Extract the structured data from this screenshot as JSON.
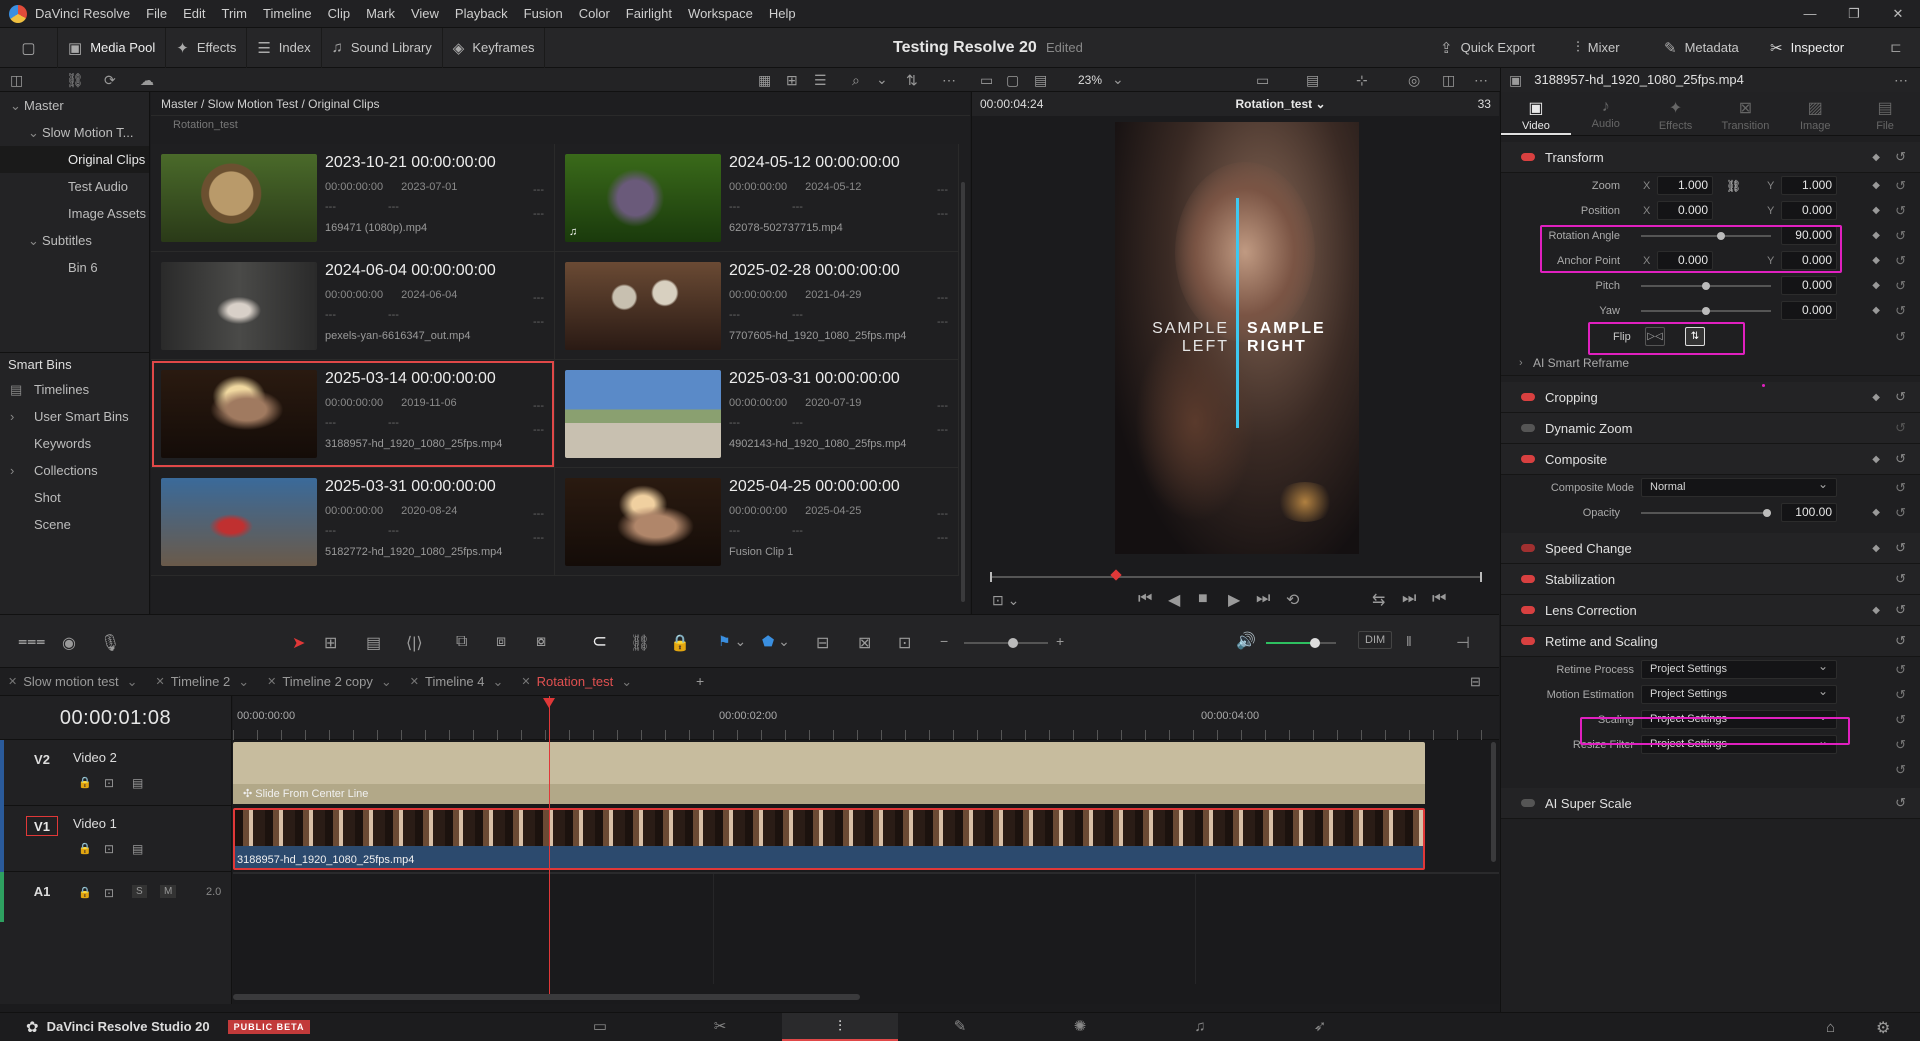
{
  "menubar": {
    "app_name": "DaVinci Resolve",
    "items": [
      "File",
      "Edit",
      "Trim",
      "Timeline",
      "Clip",
      "Mark",
      "View",
      "Playback",
      "Fusion",
      "Color",
      "Fairlight",
      "Workspace",
      "Help"
    ]
  },
  "toolbar": {
    "media_pool": "Media Pool",
    "effects": "Effects",
    "index": "Index",
    "sound_library": "Sound Library",
    "keyframes": "Keyframes",
    "project_title": "Testing Resolve 20",
    "project_status": "Edited",
    "quick_export": "Quick Export",
    "mixer": "Mixer",
    "metadata": "Metadata",
    "inspector": "Inspector",
    "zoom": "23%"
  },
  "bins": {
    "items": [
      {
        "label": "Master",
        "indent": 0,
        "arrow": "⌄"
      },
      {
        "label": "Slow Motion T...",
        "indent": 1,
        "arrow": "⌄"
      },
      {
        "label": "Original Clips",
        "indent": 2,
        "arrow": "",
        "selected": true
      },
      {
        "label": "Test Audio",
        "indent": 2,
        "arrow": ""
      },
      {
        "label": "Image Assets",
        "indent": 2,
        "arrow": ""
      },
      {
        "label": "Subtitles",
        "indent": 1,
        "arrow": "⌄"
      },
      {
        "label": "Bin 6",
        "indent": 2,
        "arrow": ""
      }
    ],
    "smart_bins_title": "Smart Bins",
    "smart_bins": [
      {
        "label": "Timelines",
        "arrow": ""
      },
      {
        "label": "User Smart Bins",
        "arrow": "›"
      },
      {
        "label": "Keywords",
        "arrow": ""
      },
      {
        "label": "Collections",
        "arrow": "›"
      },
      {
        "label": "Shot",
        "arrow": ""
      },
      {
        "label": "Scene",
        "arrow": ""
      }
    ]
  },
  "mediapool": {
    "breadcrumb": "Master / Slow Motion Test / Original Clips",
    "sub": "Rotation_test",
    "clips": [
      {
        "title": "2023-10-21  00:00:00:00",
        "tc": "00:00:00:00",
        "date": "2023-07-01",
        "file": "169471 (1080p).mp4",
        "thumb": "snail",
        "selected": false
      },
      {
        "title": "2024-05-12  00:00:00:00",
        "tc": "00:00:00:00",
        "date": "2024-05-12",
        "file": "62078-502737715.mp4",
        "thumb": "grapes",
        "selected": false
      },
      {
        "title": "2024-06-04  00:00:00:00",
        "tc": "00:00:00:00",
        "date": "2024-06-04",
        "file": "pexels-yan-6616347_out.mp4",
        "thumb": "dancer",
        "selected": false
      },
      {
        "title": "2025-02-28  00:00:00:00",
        "tc": "00:00:00:00",
        "date": "2021-04-29",
        "file": "7707605-hd_1920_1080_25fps.mp4",
        "thumb": "skulls",
        "selected": false
      },
      {
        "title": "2025-03-14  00:00:00:00",
        "tc": "00:00:00:00",
        "date": "2019-11-06",
        "file": "3188957-hd_1920_1080_25fps.mp4",
        "thumb": "woman",
        "selected": true
      },
      {
        "title": "2025-03-31  00:00:00:00",
        "tc": "00:00:00:00",
        "date": "2020-07-19",
        "file": "4902143-hd_1920_1080_25fps.mp4",
        "thumb": "skater",
        "selected": false
      },
      {
        "title": "2025-03-31  00:00:00:00",
        "tc": "00:00:00:00",
        "date": "2020-08-24",
        "file": "5182772-hd_1920_1080_25fps.mp4",
        "thumb": "baseball",
        "selected": false
      },
      {
        "title": "2025-04-25  00:00:00:00",
        "tc": "00:00:00:00",
        "date": "2025-04-25",
        "file": "Fusion Clip 1",
        "thumb": "woman2",
        "selected": false
      }
    ]
  },
  "viewer": {
    "timecode": "00:00:04:24",
    "name": "Rotation_test",
    "frame_count": "33",
    "sample_left_1": "SAMPLE",
    "sample_left_2": "LEFT",
    "sample_right_1": "SAMPLE",
    "sample_right_2": "RIGHT"
  },
  "inspector": {
    "filename": "3188957-hd_1920_1080_25fps.mp4",
    "tabs": [
      {
        "label": "Video",
        "icon": "▣",
        "active": true
      },
      {
        "label": "Audio",
        "icon": "♪",
        "active": false
      },
      {
        "label": "Effects",
        "icon": "✦",
        "active": false
      },
      {
        "label": "Transition",
        "icon": "⊠",
        "active": false
      },
      {
        "label": "Image",
        "icon": "▨",
        "active": false
      },
      {
        "label": "File",
        "icon": "▤",
        "active": false
      }
    ],
    "transform": {
      "title": "Transform",
      "zoom_label": "Zoom",
      "zoom_x": "1.000",
      "zoom_y": "1.000",
      "position_label": "Position",
      "position_x": "0.000",
      "position_y": "0.000",
      "rotation_label": "Rotation Angle",
      "rotation": "90.000",
      "rotation_level": 0.62,
      "anchor_label": "Anchor Point",
      "anchor_x": "0.000",
      "anchor_y": "0.000",
      "pitch_label": "Pitch",
      "pitch": "0.000",
      "pitch_level": 0.5,
      "yaw_label": "Yaw",
      "yaw": "0.000",
      "yaw_level": 0.5,
      "flip_label": "Flip",
      "axis_x": "X",
      "axis_y": "Y"
    },
    "ai_reframe": "AI Smart Reframe",
    "cropping": "Cropping",
    "dynamic_zoom": "Dynamic Zoom",
    "composite": {
      "title": "Composite",
      "mode_label": "Composite Mode",
      "mode": "Normal",
      "opacity_label": "Opacity",
      "opacity": "100.00",
      "opacity_level": 1.0
    },
    "speed_change": "Speed Change",
    "stabilization": "Stabilization",
    "lens_correction": "Lens Correction",
    "retime": {
      "title": "Retime and Scaling",
      "process_label": "Retime Process",
      "process": "Project Settings",
      "motion_label": "Motion Estimation",
      "motion": "Project Settings",
      "scaling_label": "Scaling",
      "scaling": "Project Settings",
      "resize_label": "Resize Filter",
      "resize": "Project Settings"
    },
    "ai_super_scale": "AI Super Scale"
  },
  "timeline": {
    "tabs": [
      {
        "label": "Slow motion test",
        "active": false
      },
      {
        "label": "Timeline 2",
        "active": false
      },
      {
        "label": "Timeline 2 copy",
        "active": false
      },
      {
        "label": "Timeline 4",
        "active": false
      },
      {
        "label": "Rotation_test",
        "active": true
      }
    ],
    "timecode": "00:00:01:08",
    "ruler": [
      "00:00:00:00",
      "00:00:02:00",
      "00:00:04:00"
    ],
    "tracks": {
      "v2_id": "V2",
      "v2_name": "Video 2",
      "v1_id": "V1",
      "v1_name": "Video 1",
      "a1_id": "A1",
      "a1_level": "2.0",
      "solo": "S",
      "mute": "M"
    },
    "v2_clip": "Slide From Center Line",
    "v1_clip": "3188957-hd_1920_1080_25fps.mp4",
    "dim": "DIM",
    "volume_level": 0.7
  },
  "statusbar": {
    "product": "DaVinci Resolve Studio 20",
    "beta": "PUBLIC BETA"
  },
  "colors": {
    "accent_red": "#e03838",
    "highlight_magenta": "#e020c0",
    "cyan_line": "#3ec8f0"
  }
}
